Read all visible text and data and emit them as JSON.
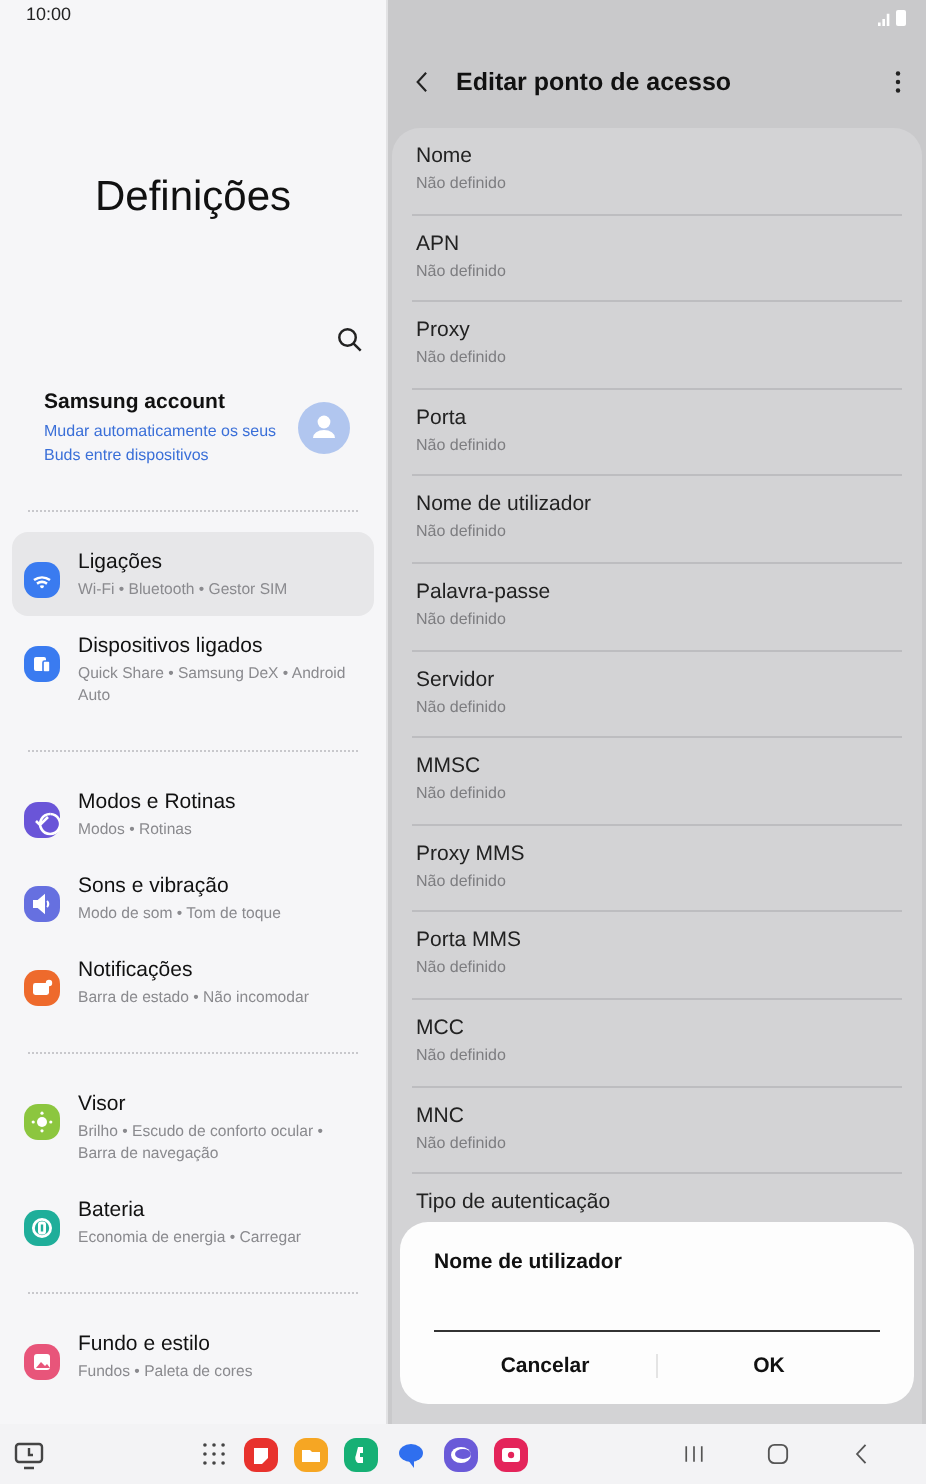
{
  "status_bar": {
    "time": "10:00"
  },
  "settings": {
    "title": "Definições",
    "account": {
      "name": "Samsung account",
      "subtitle": "Mudar automaticamente os seus Buds entre dispositivos"
    },
    "groups": [
      {
        "items": [
          {
            "title": "Ligações",
            "subtitle": "Wi-Fi • Bluetooth • Gestor SIM",
            "selected": true,
            "color": "#3a7bf0"
          },
          {
            "title": "Dispositivos ligados",
            "subtitle": "Quick Share • Samsung DeX • Android Auto",
            "selected": false,
            "color": "#3a7bf0"
          }
        ]
      },
      {
        "items": [
          {
            "title": "Modos e Rotinas",
            "subtitle": "Modos • Rotinas",
            "selected": false,
            "color": "#6a55d8"
          },
          {
            "title": "Sons e vibração",
            "subtitle": "Modo de som • Tom de toque",
            "selected": false,
            "color": "#6670e0"
          },
          {
            "title": "Notificações",
            "subtitle": "Barra de estado • Não incomodar",
            "selected": false,
            "color": "#ee6a2c"
          }
        ]
      },
      {
        "items": [
          {
            "title": "Visor",
            "subtitle": "Brilho • Escudo de conforto ocular • Barra de navegação",
            "selected": false,
            "color": "#8cc63f"
          },
          {
            "title": "Bateria",
            "subtitle": "Economia de energia • Carregar",
            "selected": false,
            "color": "#1fae9a"
          }
        ]
      },
      {
        "items": [
          {
            "title": "Fundo e estilo",
            "subtitle": "Fundos • Paleta de cores",
            "selected": false,
            "color": "#e8557a"
          }
        ]
      }
    ]
  },
  "apn": {
    "title": "Editar ponto de acesso",
    "fields": [
      {
        "label": "Nome",
        "value": "Não definido"
      },
      {
        "label": "APN",
        "value": "Não definido"
      },
      {
        "label": "Proxy",
        "value": "Não definido"
      },
      {
        "label": "Porta",
        "value": "Não definido"
      },
      {
        "label": "Nome de utilizador",
        "value": "Não definido"
      },
      {
        "label": "Palavra-passe",
        "value": "Não definido"
      },
      {
        "label": "Servidor",
        "value": "Não definido"
      },
      {
        "label": "MMSC",
        "value": "Não definido"
      },
      {
        "label": "Proxy MMS",
        "value": "Não definido"
      },
      {
        "label": "Porta MMS",
        "value": "Não definido"
      },
      {
        "label": "MCC",
        "value": "Não definido"
      },
      {
        "label": "MNC",
        "value": "Não definido"
      },
      {
        "label": "Tipo de autenticação"
      }
    ]
  },
  "dialog": {
    "title": "Nome de utilizador",
    "buttons": [
      "Cancelar",
      "OK"
    ]
  }
}
